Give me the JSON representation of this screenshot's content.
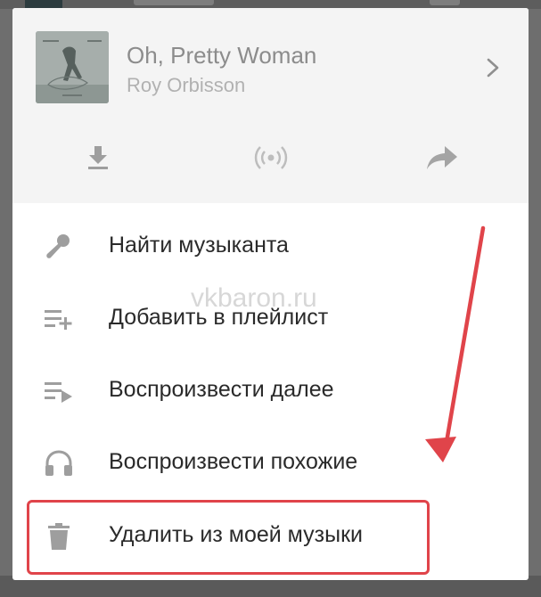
{
  "track": {
    "title": "Oh, Pretty Woman",
    "artist": "Roy Orbisson"
  },
  "actions": [
    {
      "name": "download",
      "icon": "download-icon"
    },
    {
      "name": "broadcast",
      "icon": "broadcast-icon"
    },
    {
      "name": "share",
      "icon": "share-icon"
    }
  ],
  "menu": {
    "find_artist": "Найти музыканта",
    "add_to_playlist": "Добавить в плейлист",
    "play_next": "Воспроизвести далее",
    "play_similar": "Воспроизвести похожие",
    "remove_from_my_music": "Удалить из моей музыки"
  },
  "icons": {
    "find_artist": "microphone-icon",
    "add_to_playlist": "playlist-add-icon",
    "play_next": "play-next-icon",
    "play_similar": "headphones-icon",
    "remove_from_my_music": "trash-icon"
  },
  "watermark": "vkbaron.ru",
  "colors": {
    "accent_highlight": "#e0444a",
    "icon_gray": "#9e9e9e",
    "header_bg": "#f4f4f4"
  }
}
